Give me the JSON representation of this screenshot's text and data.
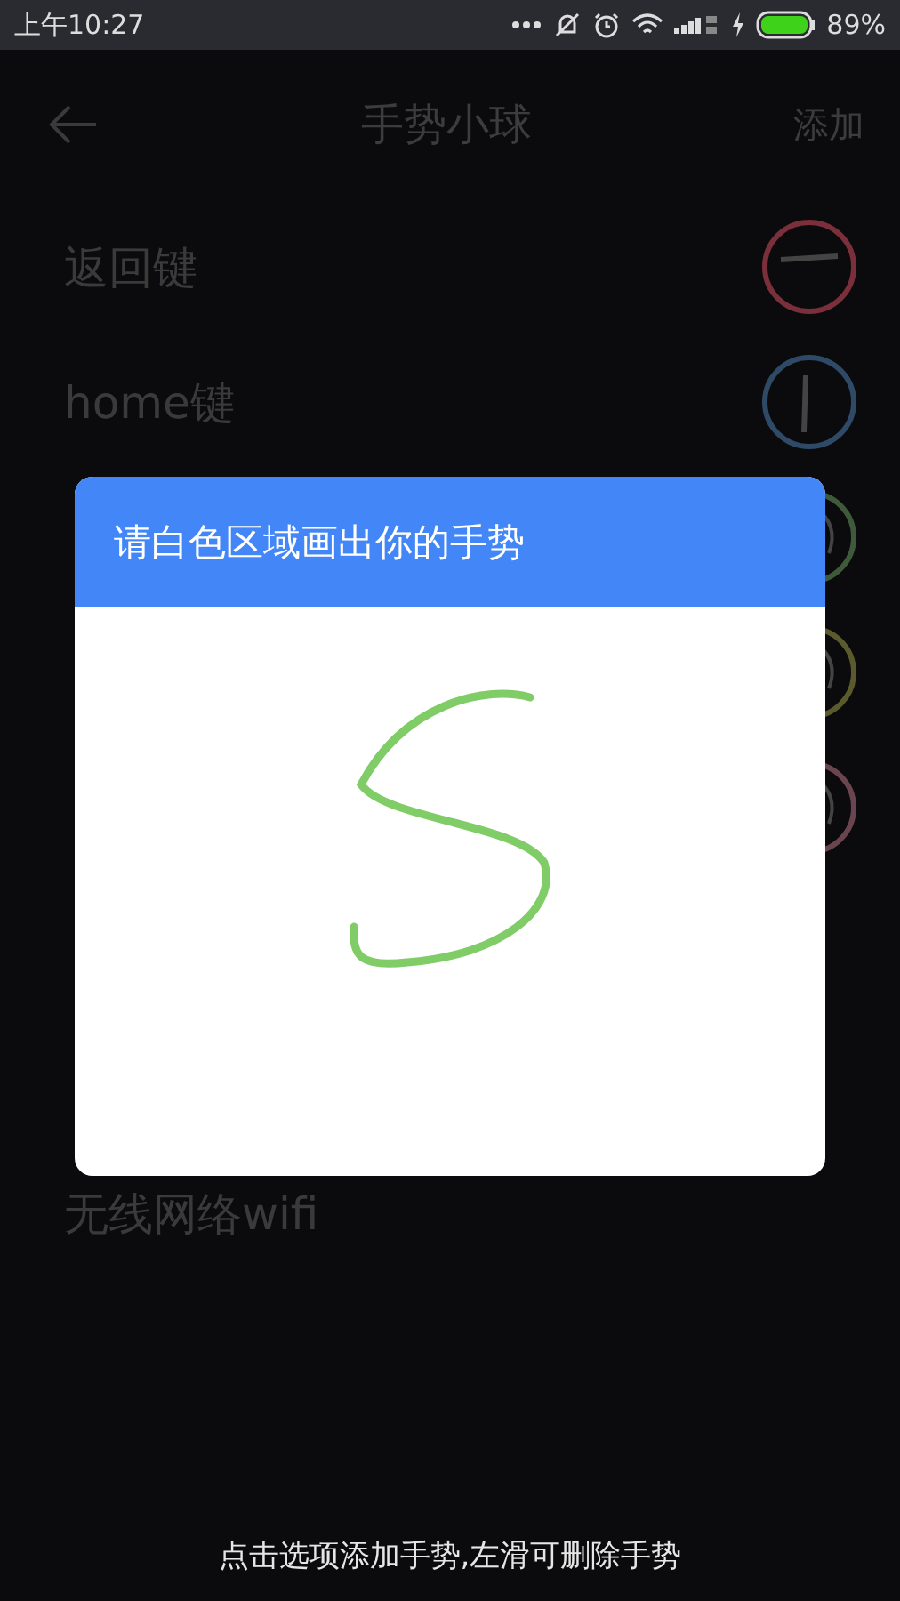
{
  "status_bar": {
    "time": "上午10:27",
    "battery": "89%"
  },
  "header": {
    "title": "手势小球",
    "action": "添加"
  },
  "rows": [
    {
      "label": "返回键",
      "gesture": {
        "kind": "dash",
        "color": "#7a2f3a"
      }
    },
    {
      "label": "home键",
      "gesture": {
        "kind": "bar",
        "color": "#2f4a66"
      }
    },
    {
      "gesture": {
        "kind": "curve",
        "color": "#3f5a3a"
      }
    },
    {
      "gesture": {
        "kind": "curve",
        "color": "#5a5a2c"
      }
    },
    {
      "gesture": {
        "kind": "curve",
        "color": "#6a4550"
      }
    },
    {},
    {},
    {
      "label": "无线网络wifi"
    }
  ],
  "dialog": {
    "title": "请白色区域画出你的手势"
  },
  "hint": "点击选项添加手势,左滑可删除手势"
}
